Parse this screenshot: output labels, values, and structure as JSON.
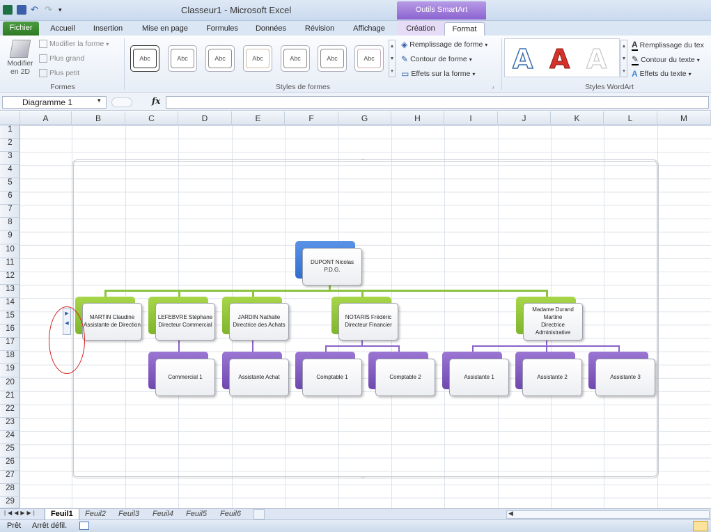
{
  "window": {
    "title": "Classeur1 - Microsoft Excel",
    "context_tab": "Outils SmartArt"
  },
  "tabs": [
    "Fichier",
    "Accueil",
    "Insertion",
    "Mise en page",
    "Formules",
    "Données",
    "Révision",
    "Affichage",
    "Création",
    "Format"
  ],
  "ribbon": {
    "formes": {
      "label": "Formes",
      "modifier_2d": "Modifier en 2D",
      "modifier_forme": "Modifier la forme",
      "plus_grand": "Plus grand",
      "plus_petit": "Plus petit"
    },
    "styles_formes": {
      "label": "Styles de formes",
      "gallery_item": "Abc",
      "remplissage": "Remplissage de forme",
      "contour": "Contour de forme",
      "effets": "Effets sur la forme"
    },
    "wordart": {
      "label": "Styles WordArt",
      "sample": "A",
      "remplissage": "Remplissage du tex",
      "contour": "Contour du texte",
      "effets": "Effets du texte"
    }
  },
  "formula_bar": {
    "name_box": "Diagramme 1",
    "fx": "fx",
    "value": ""
  },
  "grid": {
    "columns": [
      "A",
      "B",
      "C",
      "D",
      "E",
      "F",
      "G",
      "H",
      "I",
      "J",
      "K",
      "L",
      "M"
    ],
    "rows": [
      "1",
      "2",
      "3",
      "4",
      "5",
      "6",
      "7",
      "8",
      "9",
      "10",
      "11",
      "12",
      "13",
      "14",
      "15",
      "16",
      "17",
      "18",
      "19",
      "20",
      "21",
      "22",
      "23",
      "24",
      "25",
      "26",
      "27",
      "28",
      "29"
    ]
  },
  "org_chart": {
    "root": {
      "name": "DUPONT Nicolas",
      "title": "P.D.G."
    },
    "assistant": {
      "name": "MARTIN Claudine",
      "title": "Assistante de Direction"
    },
    "managers": [
      {
        "name": "LEFEBVRE Stéphane",
        "title": "Directeur Commercial"
      },
      {
        "name": "JARDIN Nathalie",
        "title": "Directrice des Achats"
      },
      {
        "name": "NOTARIS Frédéric",
        "title": "Directeur Financier"
      },
      {
        "name": "Madame Durand Martine",
        "title": "Directrice Administrative"
      }
    ],
    "staff": [
      "Commercial 1",
      "Assistante Achat",
      "Comptable 1",
      "Comptable 2",
      "Assistante 1",
      "Assistante 2",
      "Assistante 3"
    ]
  },
  "sheet_tabs": [
    "Feuil1",
    "Feuil2",
    "Feuil3",
    "Feuil4",
    "Feuil5",
    "Feuil6"
  ],
  "status": {
    "ready": "Prêt",
    "scroll": "Arrêt défil."
  },
  "colors": {
    "accent_blue": "#2f6ed0",
    "accent_green": "#7fb52c",
    "accent_purple": "#6f48b0",
    "file_tab": "#2e7a24"
  }
}
